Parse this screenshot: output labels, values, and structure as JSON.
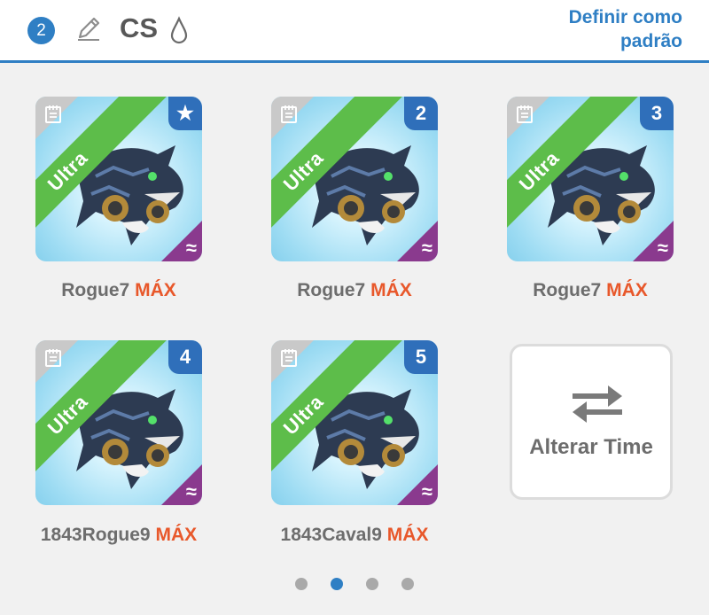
{
  "header": {
    "team_number": "2",
    "team_name": "CS",
    "set_default_line1": "Definir como",
    "set_default_line2": "padrão",
    "icons": [
      "pencil-icon",
      "drop-icon"
    ]
  },
  "cards": [
    {
      "rarity": "Ultra",
      "slot_badge": "★",
      "name": "Rogue7",
      "level": "MÁX",
      "type_symbol": "≈"
    },
    {
      "rarity": "Ultra",
      "slot_badge": "2",
      "name": "Rogue7",
      "level": "MÁX",
      "type_symbol": "≈"
    },
    {
      "rarity": "Ultra",
      "slot_badge": "3",
      "name": "Rogue7",
      "level": "MÁX",
      "type_symbol": "≈"
    },
    {
      "rarity": "Ultra",
      "slot_badge": "4",
      "name": "1843Rogue9",
      "level": "MÁX",
      "type_symbol": "≈"
    },
    {
      "rarity": "Ultra",
      "slot_badge": "5",
      "name": "1843Caval9",
      "level": "MÁX",
      "type_symbol": "≈"
    }
  ],
  "swap": {
    "label": "Alterar Time",
    "icon": "swap-arrows-icon"
  },
  "pagination": {
    "pages": 4,
    "active_page": 2
  },
  "colors": {
    "accent": "#2f7fc4",
    "max": "#e8582b",
    "ultra": "#5dbd4a",
    "type": "#8a3a8e"
  }
}
